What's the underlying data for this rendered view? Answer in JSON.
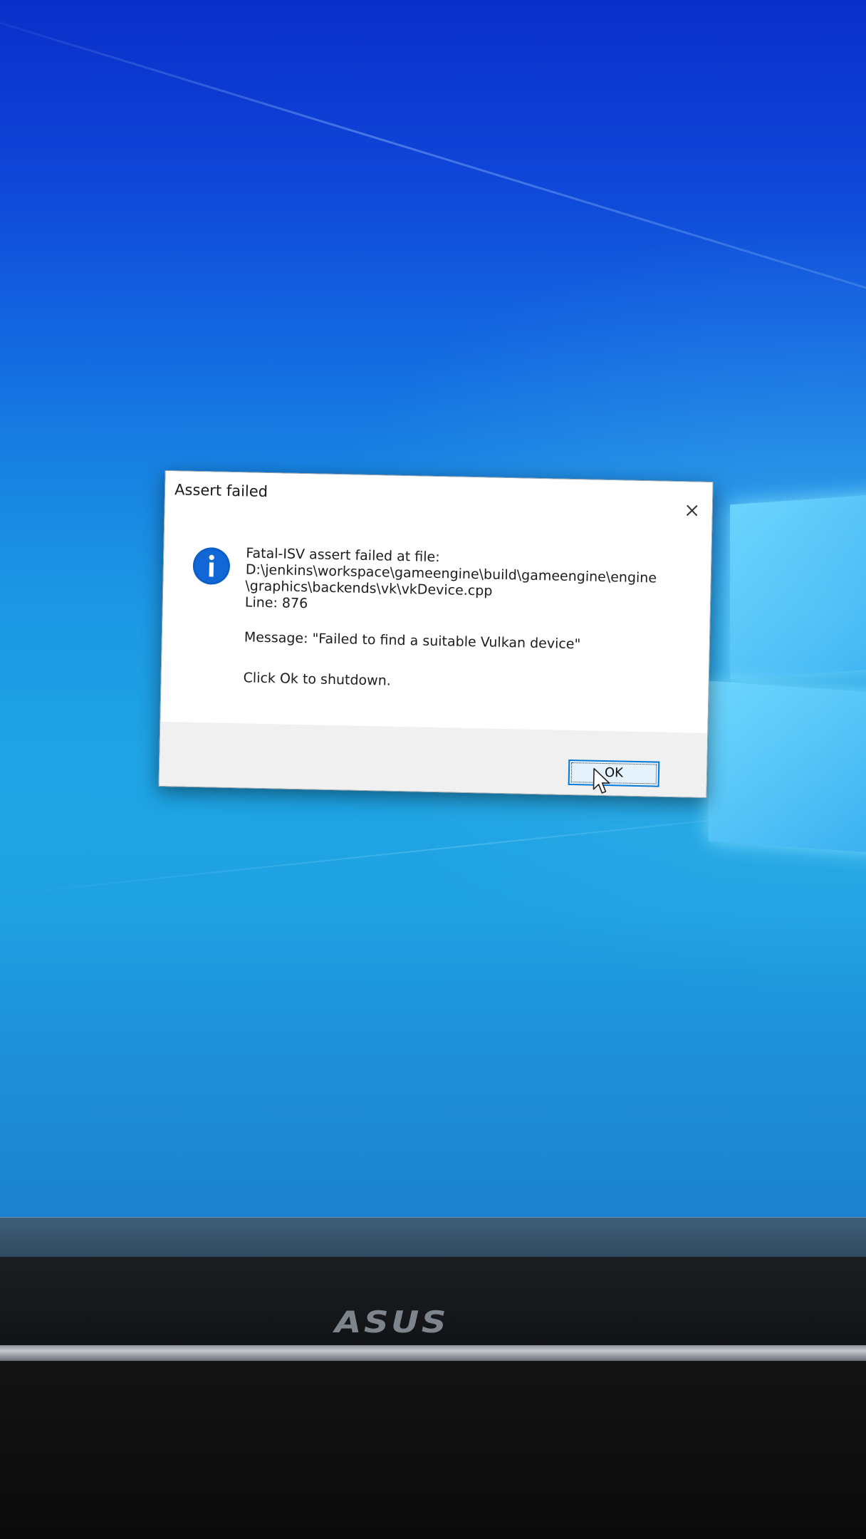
{
  "dialog": {
    "title": "Assert failed",
    "lines": {
      "line1": "Fatal-ISV assert failed at file:",
      "line2": "D:\\jenkins\\workspace\\gameengine\\build\\gameengine\\engine",
      "line3": "\\graphics\\backends\\vk\\vkDevice.cpp",
      "line4": "Line: 876",
      "message": "Message: \"Failed to find a suitable Vulkan device\"",
      "instruction": "Click Ok to shutdown."
    },
    "ok_label": "OK",
    "icons": {
      "info": "info-icon",
      "close": "close-icon"
    }
  },
  "monitor": {
    "brand": "ASUS"
  },
  "colors": {
    "accent": "#0078d7",
    "info_icon": "#0b5fc7"
  }
}
